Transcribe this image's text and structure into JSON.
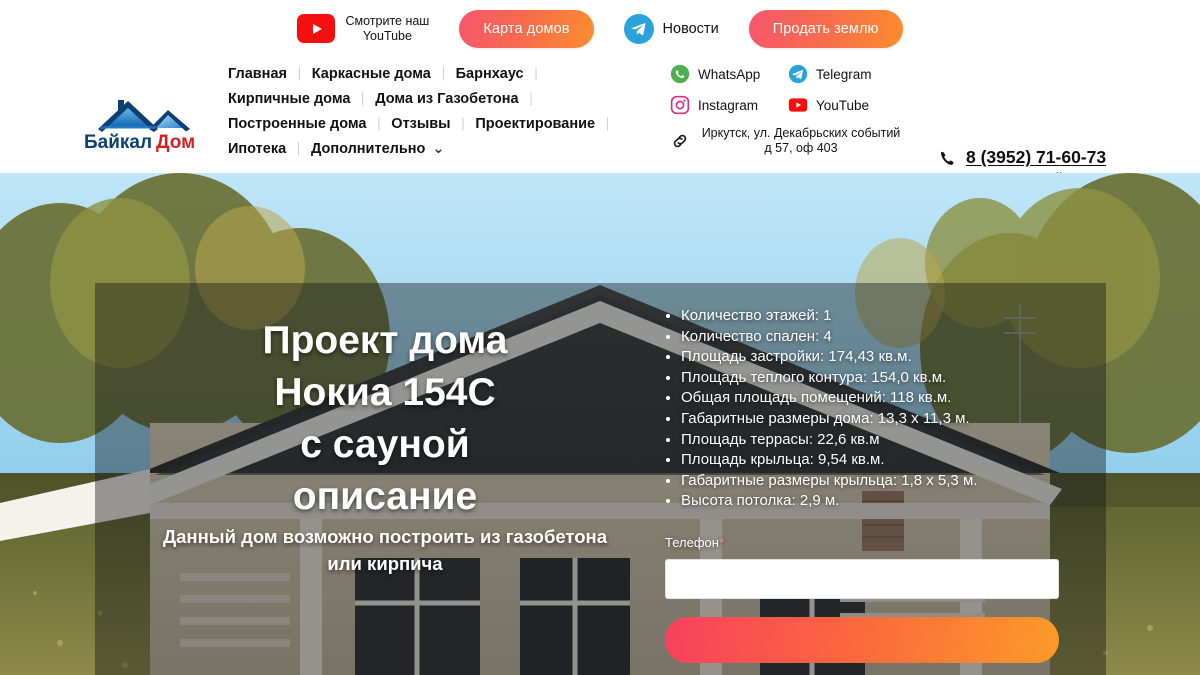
{
  "topbar": {
    "youtube_promo": {
      "icon": "youtube-icon",
      "line1": "Смотрите наш",
      "line2": "YouTube"
    },
    "map_button": "Карта домов",
    "telegram_promo": {
      "icon": "telegram-icon",
      "label": "Новости"
    },
    "sell_button": "Продать землю"
  },
  "logo": {
    "text": "Байкал Дом",
    "alt": "Байкал Дом"
  },
  "nav": {
    "rows": [
      [
        {
          "label": "Главная"
        },
        {
          "label": "Каркасные дома"
        },
        {
          "label": "Барнхаус"
        }
      ],
      [
        {
          "label": "Кирпичные дома"
        },
        {
          "label": "Дома из Газобетона"
        }
      ],
      [
        {
          "label": "Построенные дома"
        },
        {
          "label": "Отзывы"
        },
        {
          "label": "Проектирование"
        }
      ],
      [
        {
          "label": "Ипотека"
        },
        {
          "label": "Дополнительно",
          "chevron": "⌄"
        }
      ]
    ],
    "separator": "⏐"
  },
  "social": {
    "whatsapp": "WhatsApp",
    "telegram": "Telegram",
    "instagram": "Instagram",
    "youtube": "YouTube",
    "address": "Иркутск, ул. Декабрьских событий д 57, оф 403"
  },
  "contact": {
    "phone": "8 (3952) 71-60-73",
    "call_now": "Звоните сейчас"
  },
  "hero": {
    "title": "Проект дома\nНокиа 154С\nс сауной\nописание",
    "subtitle": "Данный дом возможно построить из газобетона или кирпича",
    "specs": [
      "Количество этажей: 1",
      "Количество спален: 4",
      "Площадь застройки: 174,43 кв.м.",
      "Площадь теплого контура: 154,0 кв.м.",
      "Общая площадь помещений: 118 кв.м.",
      "Габаритные размеры дома: 13,3 х 11,3 м.",
      "Площадь террасы: 22,6 кв.м",
      "Площадь крыльца: 9,54 кв.м.",
      "Габаритные размеры крыльца: 1,8 х 5,3 м.",
      "Высота потолка: 2,9 м."
    ],
    "form": {
      "label": "Телефон",
      "required_mark": "*",
      "value": "",
      "placeholder": "",
      "submit": ""
    }
  },
  "colors": {
    "gradient_start": "#f8405e",
    "gradient_end": "#fb9b28",
    "youtube_red": "#f60f0f",
    "telegram_blue": "#2aa3dd",
    "whatsapp_green": "#4caf50",
    "instagram_pink": "#d6337f",
    "logo_blue": "#1a6fc4",
    "overlay": "rgba(20,22,24,0.42)"
  }
}
